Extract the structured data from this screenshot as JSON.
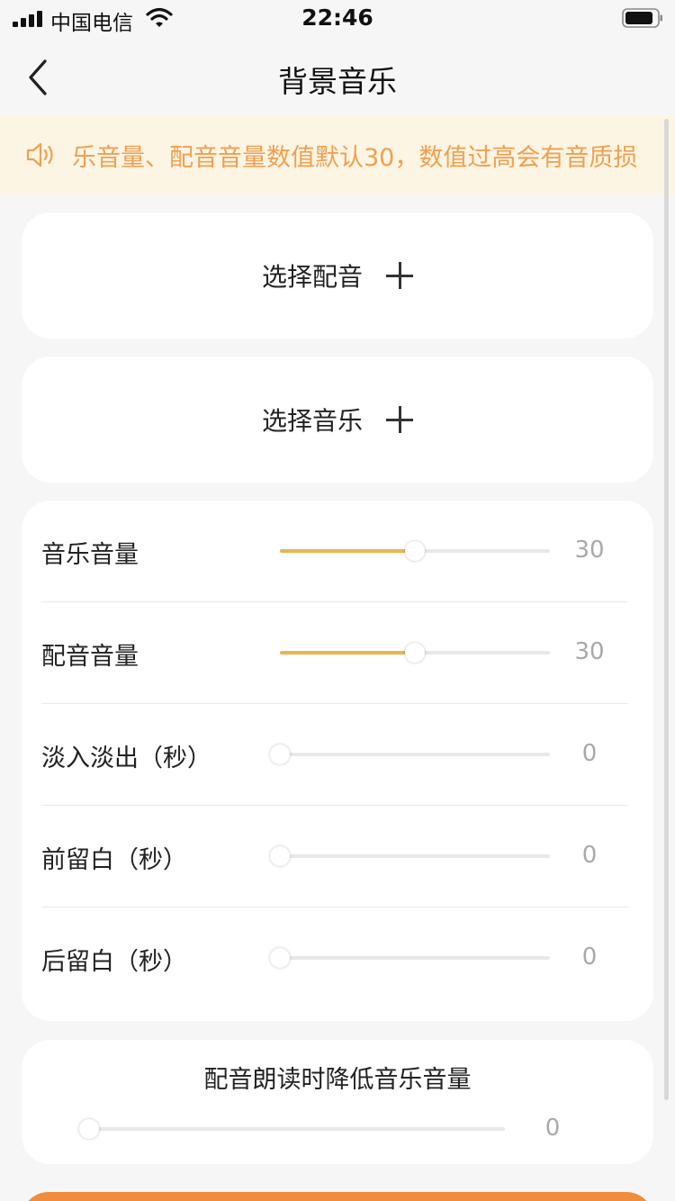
{
  "status_bar": {
    "carrier": "中国电信",
    "time": "22:46"
  },
  "nav": {
    "title": "背景音乐",
    "back_icon": "chevron-left-icon"
  },
  "notice": {
    "icon": "speaker-icon",
    "text": "乐音量、配音音量数值默认30，数值过高会有音质损"
  },
  "select_voice": {
    "label": "选择配音",
    "icon": "plus-icon"
  },
  "select_music": {
    "label": "选择音乐",
    "icon": "plus-icon"
  },
  "settings": [
    {
      "label": "音乐音量",
      "value": "30",
      "fraction": 0.5
    },
    {
      "label": "配音音量",
      "value": "30",
      "fraction": 0.5
    },
    {
      "label": "淡入淡出（秒）",
      "value": "0",
      "fraction": 0
    },
    {
      "label": "前留白（秒）",
      "value": "0",
      "fraction": 0
    },
    {
      "label": "后留白（秒）",
      "value": "0",
      "fraction": 0
    }
  ],
  "duck_music": {
    "label": "配音朗读时降低音乐音量",
    "value": "0",
    "fraction": 0
  },
  "colors": {
    "accent": "#e9b54e",
    "notice_text": "#f0a050",
    "notice_bg": "#fdf5e4",
    "primary_button": "#f08c3c"
  }
}
